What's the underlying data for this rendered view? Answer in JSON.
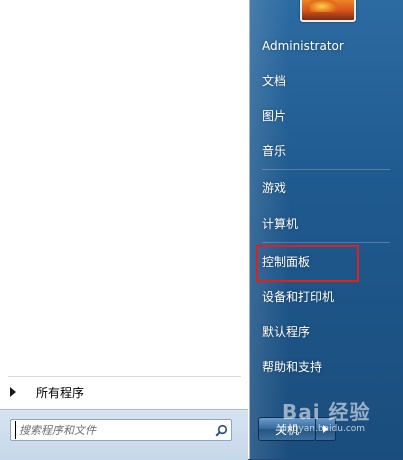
{
  "left": {
    "all_programs_label": "所有程序",
    "search_placeholder": "搜索程序和文件"
  },
  "right": {
    "user_name": "Administrator",
    "items": [
      {
        "label": "文档"
      },
      {
        "label": "图片"
      },
      {
        "label": "音乐"
      },
      {
        "label": "游戏"
      },
      {
        "label": "计算机"
      },
      {
        "label": "控制面板"
      },
      {
        "label": "设备和打印机"
      },
      {
        "label": "默认程序"
      },
      {
        "label": "帮助和支持"
      }
    ],
    "shutdown_label": "关机"
  },
  "watermark": {
    "main": "Bai 经验",
    "sub": "jingyan.baidu.com"
  },
  "colors": {
    "right_pane": "#1f5a8f",
    "highlight": "#e02020"
  }
}
